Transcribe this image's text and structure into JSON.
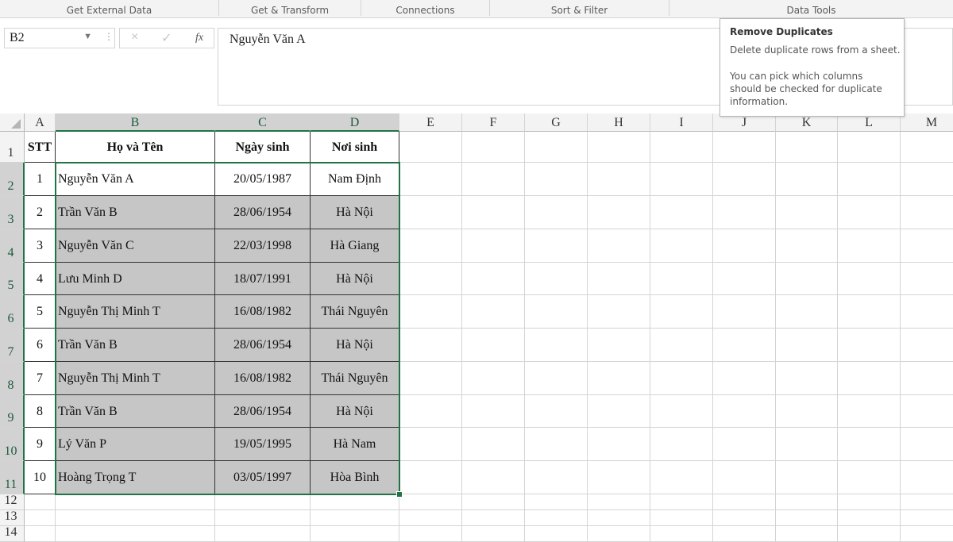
{
  "ribbon": {
    "groups": [
      "Get External Data",
      "Get & Transform",
      "Connections",
      "Sort & Filter",
      "Data Tools"
    ]
  },
  "formula_bar": {
    "name_box": "B2",
    "content": "Nguyễn Văn A",
    "cancel_icon": "×",
    "enter_icon": "✓",
    "fx_label": "fx"
  },
  "tooltip": {
    "title": "Remove Duplicates",
    "line1": "Delete duplicate rows from a sheet.",
    "line2": "You can pick which columns",
    "line3": "should be checked for duplicate",
    "line4": "information."
  },
  "columns": [
    "A",
    "B",
    "C",
    "D",
    "E",
    "F",
    "G",
    "H",
    "I",
    "J",
    "K",
    "L",
    "M"
  ],
  "rows": [
    "1",
    "2",
    "3",
    "4",
    "5",
    "6",
    "7",
    "8",
    "9",
    "10",
    "11",
    "12",
    "13",
    "14"
  ],
  "headers": [
    "STT",
    "Họ và Tên",
    "Ngày sinh",
    "Nơi sinh"
  ],
  "records": [
    [
      "1",
      "Nguyễn Văn A",
      "20/05/1987",
      "Nam Định"
    ],
    [
      "2",
      "Trần Văn B",
      "28/06/1954",
      "Hà Nội"
    ],
    [
      "3",
      "Nguyễn Văn C",
      "22/03/1998",
      "Hà Giang"
    ],
    [
      "4",
      "Lưu Minh D",
      "18/07/1991",
      "Hà Nội"
    ],
    [
      "5",
      "Nguyễn Thị Minh T",
      "16/08/1982",
      "Thái Nguyên"
    ],
    [
      "6",
      "Trần Văn B",
      "28/06/1954",
      "Hà Nội"
    ],
    [
      "7",
      "Nguyễn Thị Minh T",
      "16/08/1982",
      "Thái Nguyên"
    ],
    [
      "8",
      "Trần Văn B",
      "28/06/1954",
      "Hà Nội"
    ],
    [
      "9",
      "Lý Văn P",
      "19/05/1995",
      "Hà Nam"
    ],
    [
      "10",
      "Hoàng Trọng T",
      "03/05/1997",
      "Hòa Bình"
    ]
  ],
  "selection": {
    "range": "B2:D11",
    "active_cell": "B2"
  },
  "colors": {
    "selection_border": "#217346",
    "selection_fill": "#c6c6c6",
    "header_fill": "#f3f3f3"
  }
}
